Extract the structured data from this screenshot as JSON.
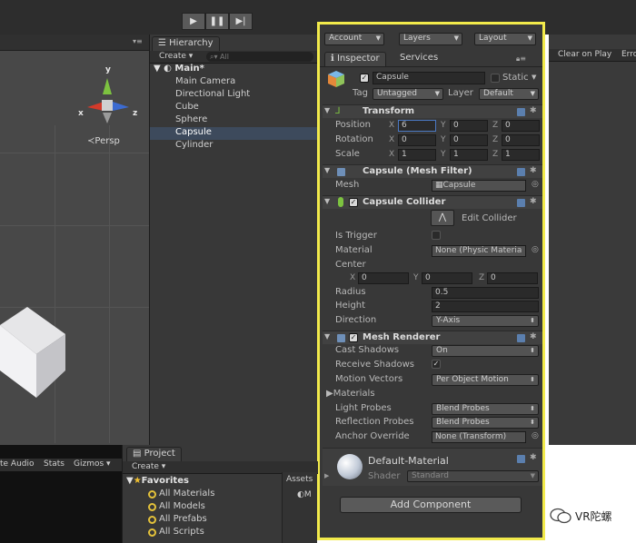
{
  "toolbar": {
    "play_icon": "play-icon",
    "pause_icon": "pause-icon",
    "step_icon": "step-icon",
    "account": "Account",
    "layers": "Layers",
    "layout": "Layout"
  },
  "scene": {
    "persp_label": "Persp",
    "axis_y": "y",
    "axis_x": "x",
    "axis_z": "z",
    "bottom_tabs": [
      "te Audio",
      "Stats",
      "Gizmos"
    ]
  },
  "hierarchy": {
    "tab": "Hierarchy",
    "create": "Create",
    "search_placeholder": "All",
    "scene_name": "Main*",
    "items": [
      "Main Camera",
      "Directional Light",
      "Cube",
      "Sphere",
      "Capsule",
      "Cylinder"
    ],
    "selected": "Capsule"
  },
  "right_strip": {
    "clear_on_play": "Clear on Play",
    "erro": "Erro"
  },
  "inspector": {
    "tab": "Inspector",
    "services_tab": "Services",
    "object_name": "Capsule",
    "static_label": "Static",
    "tag_label": "Tag",
    "tag_value": "Untagged",
    "layer_label": "Layer",
    "layer_value": "Default",
    "transform": {
      "title": "Transform",
      "position_label": "Position",
      "rotation_label": "Rotation",
      "scale_label": "Scale",
      "x": "X",
      "y": "Y",
      "z": "Z",
      "position": [
        "6",
        "0",
        "0"
      ],
      "rotation": [
        "0",
        "0",
        "0"
      ],
      "scale": [
        "1",
        "1",
        "1"
      ]
    },
    "mesh_filter": {
      "title": "Capsule (Mesh Filter)",
      "mesh_label": "Mesh",
      "mesh_value": "Capsule"
    },
    "capsule_collider": {
      "title": "Capsule Collider",
      "edit_collider": "Edit Collider",
      "is_trigger_label": "Is Trigger",
      "material_label": "Material",
      "material_value": "None (Physic Materia",
      "center_label": "Center",
      "center": [
        "0",
        "0",
        "0"
      ],
      "radius_label": "Radius",
      "radius_value": "0.5",
      "height_label": "Height",
      "height_value": "2",
      "direction_label": "Direction",
      "direction_value": "Y-Axis"
    },
    "mesh_renderer": {
      "title": "Mesh Renderer",
      "cast_shadows_label": "Cast Shadows",
      "cast_shadows_value": "On",
      "receive_shadows_label": "Receive Shadows",
      "motion_vectors_label": "Motion Vectors",
      "motion_vectors_value": "Per Object Motion",
      "materials_label": "Materials",
      "light_probes_label": "Light Probes",
      "light_probes_value": "Blend Probes",
      "reflection_probes_label": "Reflection Probes",
      "reflection_probes_value": "Blend Probes",
      "anchor_override_label": "Anchor Override",
      "anchor_override_value": "None (Transform)"
    },
    "material": {
      "name": "Default-Material",
      "shader_label": "Shader",
      "shader_value": "Standard"
    },
    "add_component": "Add Component"
  },
  "project": {
    "tab": "Project",
    "create": "Create",
    "favorites": "Favorites",
    "items": [
      "All Materials",
      "All Models",
      "All Prefabs",
      "All Scripts"
    ],
    "assets_tab": "Assets",
    "assets_item": "M"
  },
  "watermark": "VR陀螺",
  "colors": {
    "highlight_border": "#f2ea4b",
    "selection": "#3d4a5c",
    "panel": "#383838"
  }
}
